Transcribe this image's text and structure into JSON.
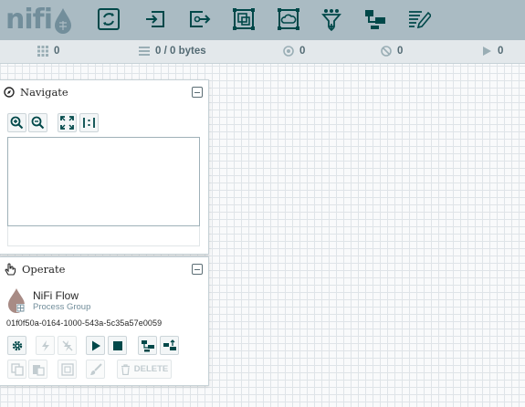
{
  "colors": {
    "header_bg": "#aabbc3",
    "icon_dark": "#004849",
    "icon_mid": "#728e9b",
    "disabled": "#c2ccd0"
  },
  "header": {
    "logo_text": "nifi",
    "tools": [
      {
        "name": "processor-icon"
      },
      {
        "name": "input-port-icon"
      },
      {
        "name": "output-port-icon"
      },
      {
        "name": "process-group-icon"
      },
      {
        "name": "remote-process-group-icon"
      },
      {
        "name": "funnel-icon"
      },
      {
        "name": "template-icon"
      },
      {
        "name": "label-icon"
      }
    ]
  },
  "status": {
    "active_threads": "0",
    "queued": "0 / 0 bytes",
    "transmitting": "0",
    "not_transmitting": "0",
    "running": "0"
  },
  "navigate": {
    "title": "Navigate"
  },
  "operate": {
    "title": "Operate",
    "component_name": "NiFi Flow",
    "component_type": "Process Group",
    "component_id": "01f0f50a-0164-1000-543a-5c35a57e0059",
    "delete_label": "DELETE"
  }
}
